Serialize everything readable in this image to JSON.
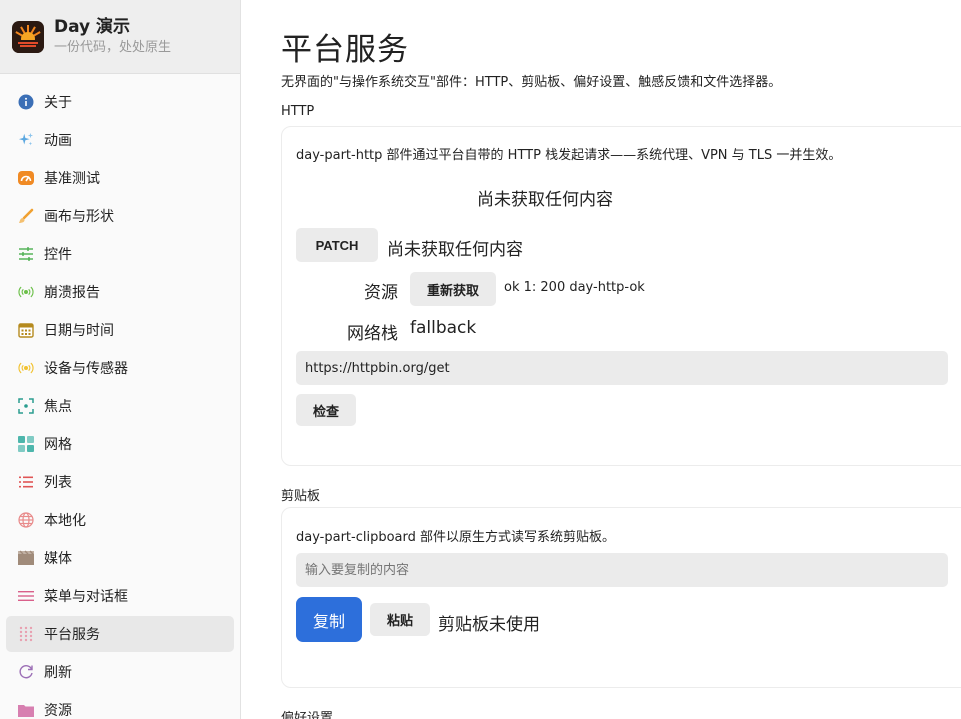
{
  "app": {
    "title": "Day 演示",
    "subtitle": "一份代码，处处原生"
  },
  "sidebar": {
    "items": [
      {
        "label": "关于",
        "icon": "info-icon",
        "color": "#3b6fb6"
      },
      {
        "label": "动画",
        "icon": "sparkles-icon",
        "color": "#5aa7e0"
      },
      {
        "label": "基准测试",
        "icon": "speedometer-icon",
        "color": "#f08a24"
      },
      {
        "label": "画布与形状",
        "icon": "brush-icon",
        "color": "#f0a030"
      },
      {
        "label": "控件",
        "icon": "sliders-icon",
        "color": "#4caf50"
      },
      {
        "label": "崩溃报告",
        "icon": "broadcast-icon",
        "color": "#6cc04a"
      },
      {
        "label": "日期与时间",
        "icon": "calendar-icon",
        "color": "#b58a1e"
      },
      {
        "label": "设备与传感器",
        "icon": "sensor-icon",
        "color": "#f2c230"
      },
      {
        "label": "焦点",
        "icon": "focus-icon",
        "color": "#2a9d8f"
      },
      {
        "label": "网格",
        "icon": "grid-icon",
        "color": "#4db6ac"
      },
      {
        "label": "列表",
        "icon": "list-icon",
        "color": "#e05555"
      },
      {
        "label": "本地化",
        "icon": "globe-icon",
        "color": "#e88a8a"
      },
      {
        "label": "媒体",
        "icon": "film-icon",
        "color": "#a08b7a"
      },
      {
        "label": "菜单与对话框",
        "icon": "menu-icon",
        "color": "#d95f8a"
      },
      {
        "label": "平台服务",
        "icon": "dots-grid-icon",
        "color": "#e8a0b0"
      },
      {
        "label": "刷新",
        "icon": "refresh-icon",
        "color": "#9c6fb6"
      },
      {
        "label": "资源",
        "icon": "folder-icon",
        "color": "#d77fb0"
      }
    ],
    "active_index": 14
  },
  "page": {
    "title": "平台服务",
    "description": "无界面的\"与操作系统交互\"部件：HTTP、剪贴板、偏好设置、触感反馈和文件选择器。"
  },
  "http": {
    "section_label": "HTTP",
    "description": "day-part-http 部件通过平台自带的 HTTP 栈发起请求——系统代理、VPN 与 TLS 一并生效。",
    "status_text": "尚未获取任何内容",
    "patch_button": "PATCH",
    "patch_result": "尚未获取任何内容",
    "resource_label": "资源",
    "refetch_button": "重新获取",
    "resource_result": "ok 1: 200 day-http-ok",
    "stack_label": "网络栈",
    "stack_value": "fallback",
    "url_value": "https://httpbin.org/get",
    "inspect_button": "检查"
  },
  "clipboard": {
    "section_label": "剪贴板",
    "description": "day-part-clipboard 部件以原生方式读写系统剪贴板。",
    "input_placeholder": "输入要复制的内容",
    "copy_button": "复制",
    "paste_button": "粘贴",
    "status_text": "剪贴板未使用"
  },
  "preferences": {
    "section_label": "偏好设置"
  }
}
